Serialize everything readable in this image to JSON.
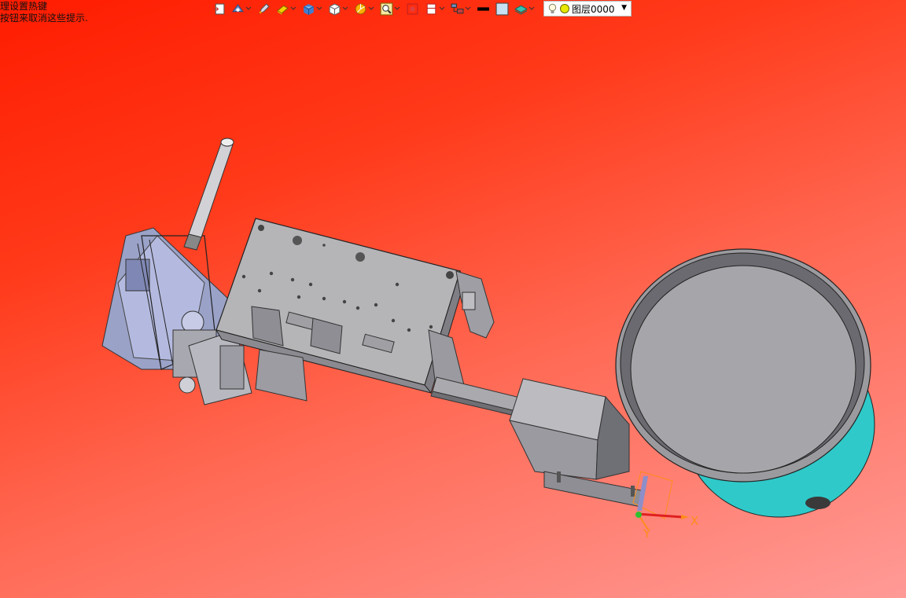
{
  "hint": {
    "line1": "理设置热键",
    "line2": "按钮来取消这些提示."
  },
  "toolbar": {
    "items": [
      {
        "icon": "window-icon",
        "dropdown": false
      },
      {
        "icon": "eye-view-icon",
        "dropdown": true
      },
      {
        "icon": "pen-icon",
        "dropdown": false
      },
      {
        "icon": "eraser-icon",
        "dropdown": true
      },
      {
        "icon": "shaded-cube-icon",
        "dropdown": true
      },
      {
        "icon": "wire-cube-icon",
        "dropdown": true
      },
      {
        "icon": "render-sphere-icon",
        "dropdown": true
      },
      {
        "icon": "zoom-fit-icon",
        "dropdown": true
      },
      {
        "icon": "section-icon",
        "dropdown": false
      },
      {
        "icon": "clip-plane-icon",
        "dropdown": true
      },
      {
        "icon": "assembly-tree-icon",
        "dropdown": true
      },
      {
        "icon": "line-weight-icon",
        "dropdown": false
      },
      {
        "icon": "fill-color-icon",
        "dropdown": false
      },
      {
        "icon": "layer-stack-icon",
        "dropdown": true
      }
    ],
    "layer_select": {
      "value": "图层0000"
    }
  },
  "viewport": {
    "axis_x": "X",
    "axis_y": "Y",
    "colors": {
      "background_top": "#ff1c00",
      "background_bottom": "#ff9a96",
      "part_gray": "#a8a8ac",
      "part_blue": "#9aa2d4",
      "bowl_cyan": "#3ad8d8",
      "axis_orange": "#ff8c1a"
    }
  }
}
